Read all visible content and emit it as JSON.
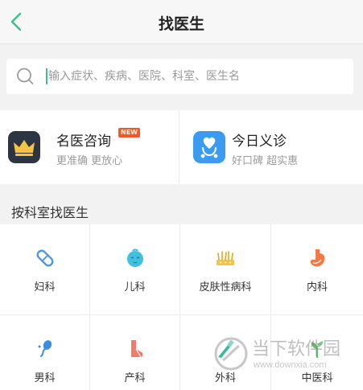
{
  "header": {
    "title": "找医生",
    "back_icon": "chevron-left-icon"
  },
  "search": {
    "placeholder": "输入症状、疾病、医院、科室、医生名",
    "value": ""
  },
  "promos": [
    {
      "title": "名医咨询",
      "subtitle": "更准确  更放心",
      "badge": "NEW",
      "icon": "crown-icon"
    },
    {
      "title": "今日义诊",
      "subtitle": "好口碑 超实惠",
      "icon": "stethoscope-heart-icon"
    }
  ],
  "section": {
    "title": "按科室找医生"
  },
  "departments": [
    {
      "label": "妇科",
      "icon": "pill-icon"
    },
    {
      "label": "儿科",
      "icon": "baby-face-icon"
    },
    {
      "label": "皮肤性病科",
      "icon": "skin-hair-icon"
    },
    {
      "label": "内科",
      "icon": "stomach-icon"
    },
    {
      "label": "男科",
      "icon": "sperm-icon"
    },
    {
      "label": "产科",
      "icon": "boot-icon"
    },
    {
      "label": "外科",
      "icon": "scalpel-icon"
    },
    {
      "label": "中医科",
      "icon": "herb-icon"
    }
  ],
  "watermark": {
    "text": "当下软件园",
    "url": "www.downxia.com"
  },
  "colors": {
    "accent": "#3bbf8e",
    "badge": "#f05a28",
    "crown_bg": "#2e3542",
    "crown": "#f6c444",
    "blue": "#3a9bf0",
    "cyan": "#3fc1e0",
    "orange": "#f27a47"
  }
}
